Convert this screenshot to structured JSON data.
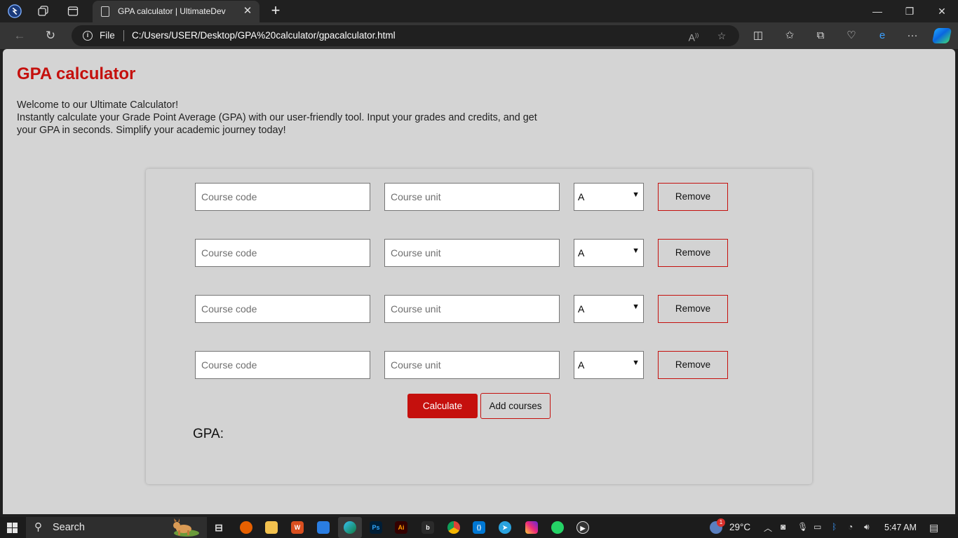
{
  "browser": {
    "tab_title": "GPA calculator | UltimateDev",
    "address_scheme": "File",
    "url": "C:/Users/USER/Desktop/GPA%20calculator/gpacalculator.html"
  },
  "page": {
    "title": "GPA calculator",
    "intro_line1": "Welcome to our Ultimate Calculator!",
    "intro_line2": "Instantly calculate your Grade Point Average (GPA) with our user-friendly tool. Input your grades and credits, and get your GPA in seconds. Simplify your academic journey today!"
  },
  "form": {
    "course_code_placeholder": "Course code",
    "course_unit_placeholder": "Course unit",
    "remove_label": "Remove",
    "rows": [
      {
        "grade": "A"
      },
      {
        "grade": "A"
      },
      {
        "grade": "A"
      },
      {
        "grade": "A"
      }
    ],
    "calculate_label": "Calculate",
    "add_courses_label": "Add courses",
    "gpa_label": "GPA:"
  },
  "taskbar": {
    "search_text": "Search",
    "temperature": "29°C",
    "time": "5:47 AM",
    "notification_count": "1"
  },
  "colors": {
    "accent": "#c5100d",
    "page_bg": "#d4d4d4"
  }
}
